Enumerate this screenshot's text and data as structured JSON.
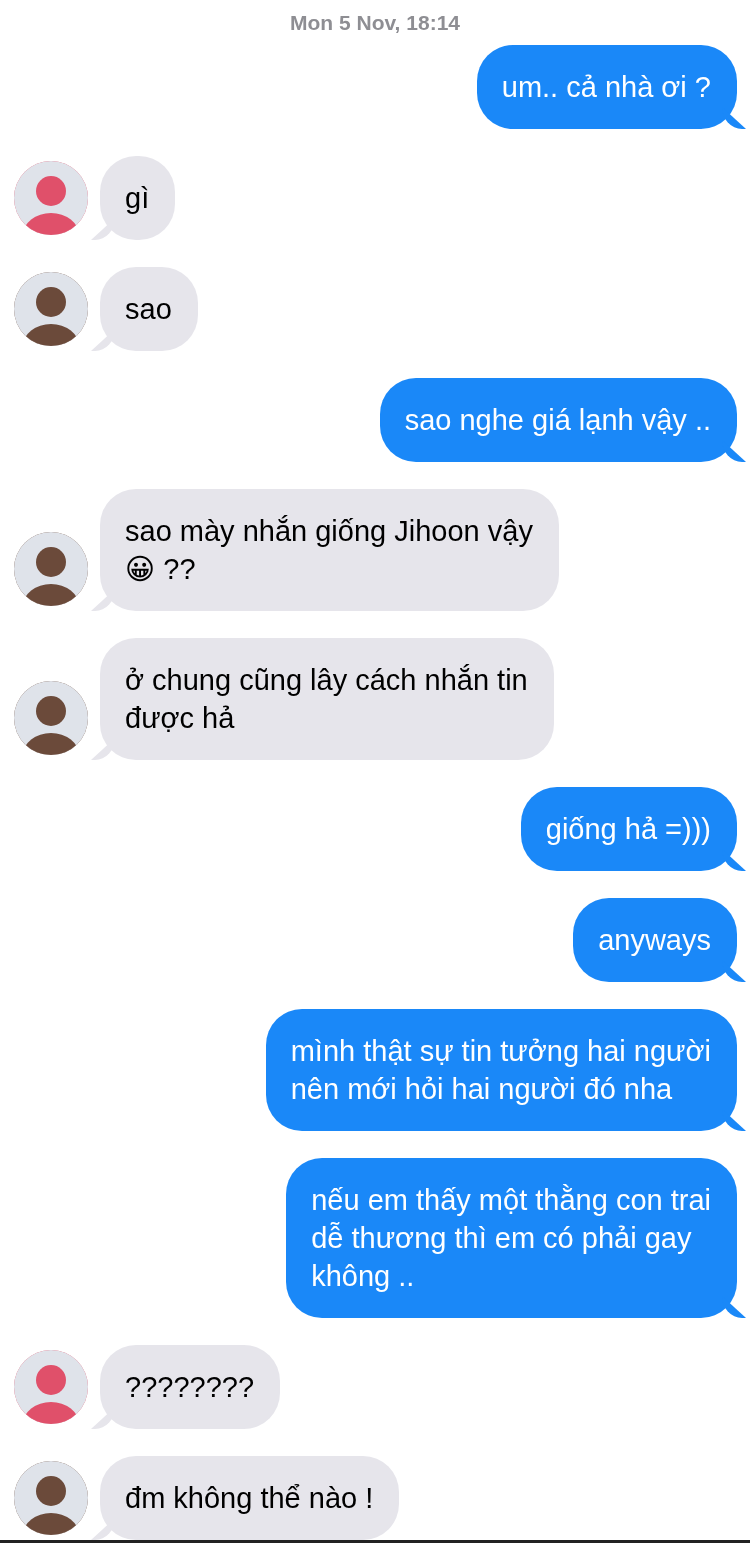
{
  "timestamp": "Mon 5 Nov, 18:14",
  "messages": [
    {
      "kind": "sent",
      "lines": [
        "um.. cả nhà ơi ?"
      ]
    },
    {
      "kind": "received",
      "color": "#e0506a",
      "lines": [
        "gì"
      ]
    },
    {
      "kind": "received",
      "color": "#6b4a3a",
      "lines": [
        "sao"
      ]
    },
    {
      "kind": "sent",
      "lines": [
        "sao nghe giá lạnh vậy .."
      ]
    },
    {
      "kind": "received",
      "color": "#6b4a3a",
      "lines": [
        "sao mày nhắn giống Jihoon vậy",
        "😀 ??"
      ]
    },
    {
      "kind": "received",
      "color": "#6b4a3a",
      "lines": [
        "ở chung cũng lây cách nhắn tin",
        "được hả"
      ]
    },
    {
      "kind": "sent",
      "lines": [
        "giống hả =)))"
      ]
    },
    {
      "kind": "sent",
      "lines": [
        "anyways"
      ]
    },
    {
      "kind": "sent",
      "lines": [
        "mình thật sự tin tưởng hai người",
        "nên mới hỏi hai người đó nha"
      ]
    },
    {
      "kind": "sent",
      "lines": [
        "nếu em thấy một thằng con trai",
        "dễ thương thì em có phải gay",
        "không .."
      ]
    },
    {
      "kind": "received",
      "color": "#e0506a",
      "lines": [
        "????????"
      ]
    },
    {
      "kind": "received",
      "color": "#6b4a3a",
      "lines": [
        "đm không thể nào !"
      ]
    }
  ]
}
